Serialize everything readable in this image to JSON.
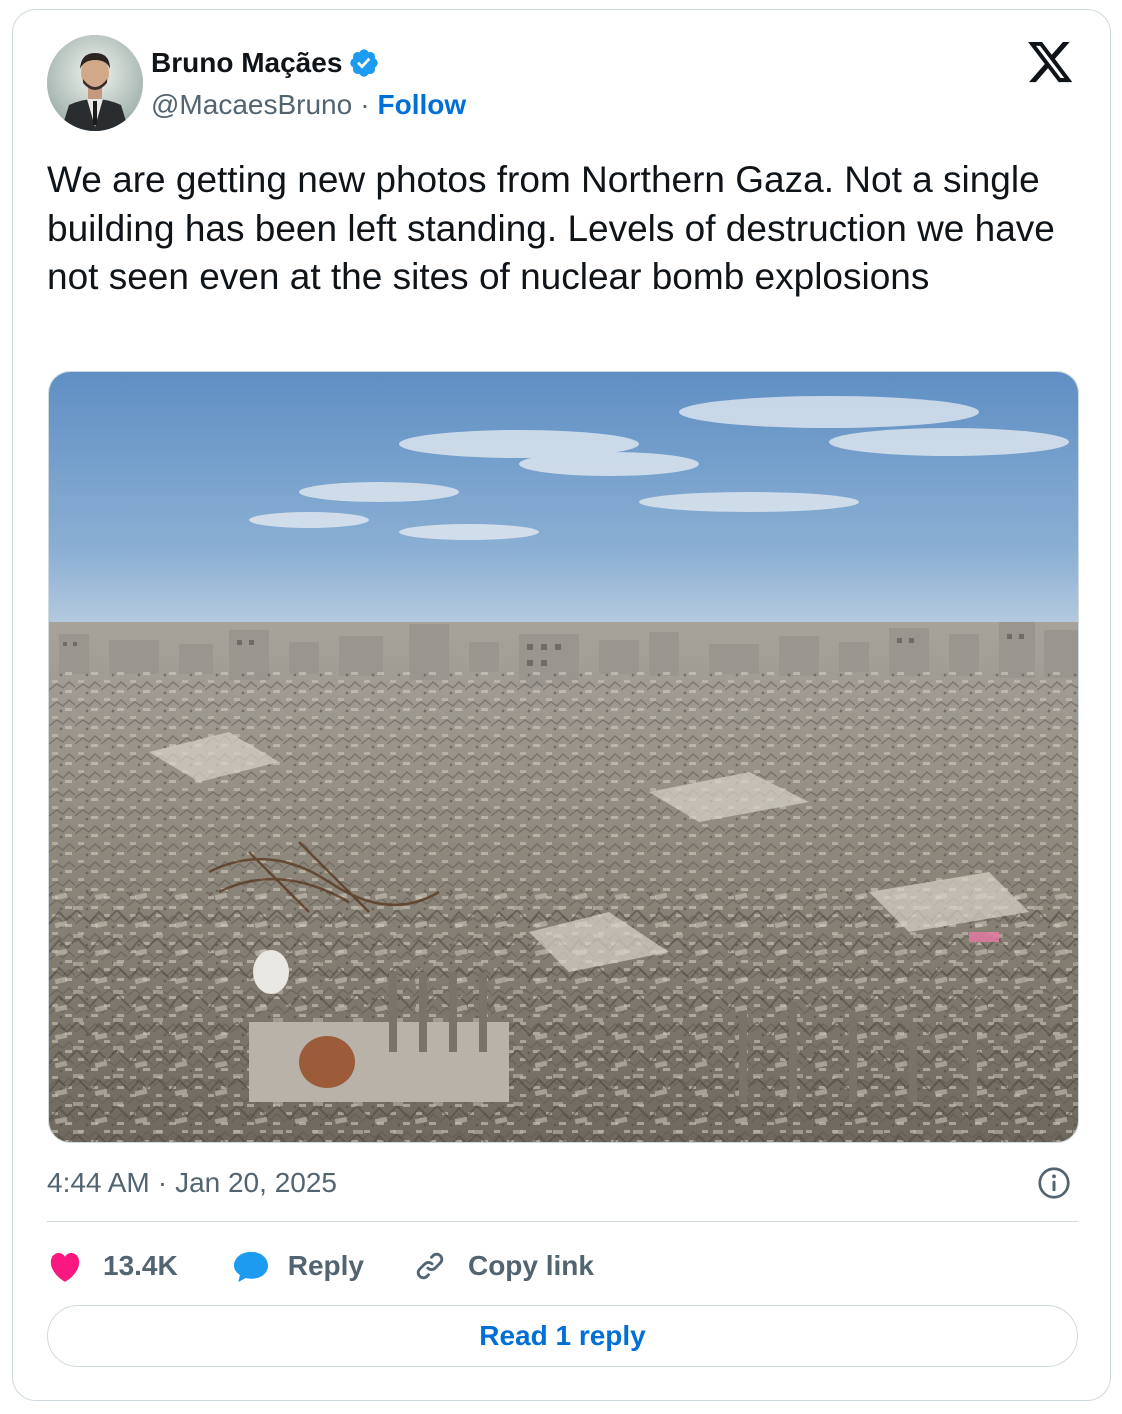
{
  "author": {
    "display_name": "Bruno Maçães",
    "handle": "@MacaesBruno",
    "separator": "·",
    "follow_label": "Follow",
    "verified": true
  },
  "tweet": {
    "text": "We are getting new photos from Northern Gaza. Not a single building has been left standing. Levels of destruction we have not seen even at the sites of nuclear bomb explosions",
    "time": "4:44 AM",
    "separator": "·",
    "date": "Jan 20, 2025"
  },
  "actions": {
    "like_count": "13.4K",
    "reply_label": "Reply",
    "copy_link_label": "Copy link"
  },
  "read_replies_label": "Read 1 reply",
  "icons": {
    "brand": "x-logo-icon",
    "verified": "verified-badge-icon",
    "info": "info-icon",
    "like": "heart-icon",
    "reply": "speech-bubble-icon",
    "copy": "link-icon"
  },
  "colors": {
    "accent": "#006fd6",
    "like": "#f91880",
    "reply_icon": "#1d9bf0",
    "text_primary": "#0f1419",
    "text_secondary": "#536471",
    "border": "#cfd9de"
  }
}
